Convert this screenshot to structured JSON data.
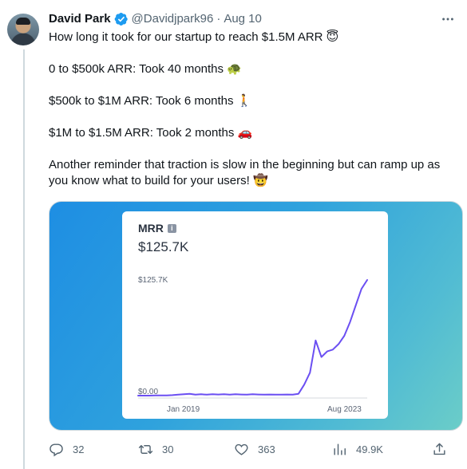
{
  "tweet": {
    "author_name": "David Park",
    "handle": "@Davidjpark96",
    "separator": "·",
    "date": "Aug 10",
    "lines": [
      "How long it took for our startup to reach $1.5M ARR 😇",
      "0 to $500k ARR: Took 40 months 🐢",
      "$500k to $1M ARR: Took 6 months 🚶",
      "$1M to $1.5M ARR: Took 2 months 🚗",
      "Another reminder that traction is slow in the beginning but can ramp up as",
      "you know what to build for your users! 🤠"
    ]
  },
  "media": {
    "card_title": "MRR",
    "info_icon_glyph": "i",
    "card_value": "$125.7K"
  },
  "chart_data": {
    "type": "line",
    "title": "MRR",
    "y_tick_labels": [
      "$125.7K",
      "$0.00"
    ],
    "x_tick_labels": [
      "Jan 2019",
      "Aug 2023"
    ],
    "ylim": [
      0,
      125.7
    ],
    "series_color": "#6b4ff2",
    "series": [
      {
        "values": [
          0,
          0,
          0,
          0.3,
          0.3,
          0.2,
          0.5,
          1.0,
          1.5,
          2.0,
          1.0,
          1.5,
          1.0,
          1.5,
          1.2,
          1.5,
          1.0,
          1.5,
          1.2,
          1.0,
          1.5,
          1.2,
          1.0,
          1.2,
          1.0,
          1.0,
          1.2,
          1.0,
          2.0,
          12.0,
          25.0,
          60.0,
          42.0,
          48.0,
          50.0,
          56.0,
          65.0,
          80.0,
          98.0,
          116.0,
          125.7
        ]
      }
    ]
  },
  "actions": {
    "replies": "32",
    "retweets": "30",
    "likes": "363",
    "views": "49.9K"
  },
  "icons": {
    "verified": "verified-badge-icon",
    "more": "more-icon",
    "reply": "reply-icon",
    "retweet": "retweet-icon",
    "like": "like-icon",
    "views": "views-icon",
    "share": "share-icon"
  }
}
